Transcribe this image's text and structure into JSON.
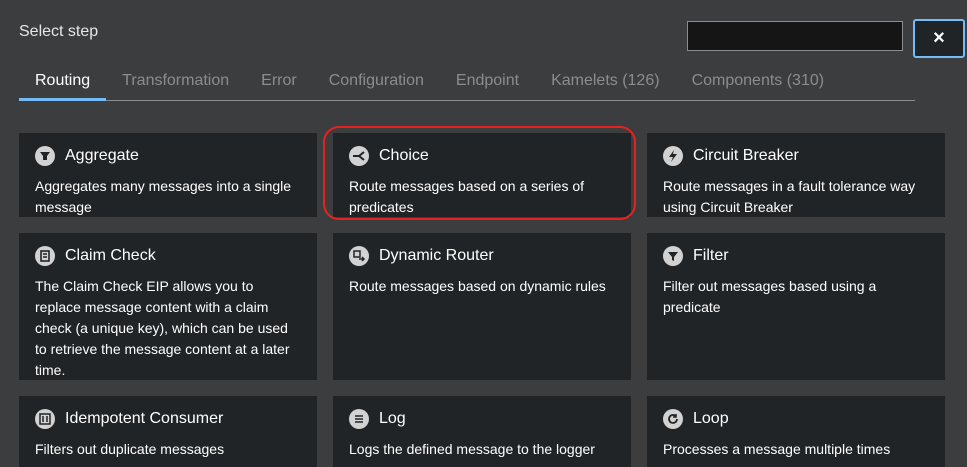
{
  "header": {
    "title": "Select step",
    "search_value": "",
    "close_label": "×"
  },
  "tabs": [
    {
      "label": "Routing",
      "active": true
    },
    {
      "label": "Transformation",
      "active": false
    },
    {
      "label": "Error",
      "active": false
    },
    {
      "label": "Configuration",
      "active": false
    },
    {
      "label": "Endpoint",
      "active": false
    },
    {
      "label": "Kamelets (126)",
      "active": false
    },
    {
      "label": "Components (310)",
      "active": false
    }
  ],
  "cards": [
    {
      "title": "Aggregate",
      "description": "Aggregates many messages into a single message",
      "icon": "aggregate-icon"
    },
    {
      "title": "Choice",
      "description": "Route messages based on a series of predicates",
      "icon": "choice-icon"
    },
    {
      "title": "Circuit Breaker",
      "description": "Route messages in a fault tolerance way using Circuit Breaker",
      "icon": "circuit-breaker-icon"
    },
    {
      "title": "Claim Check",
      "description": "The Claim Check EIP allows you to replace message content with a claim check (a unique key), which can be used to retrieve the message content at a later time.",
      "icon": "claim-check-icon"
    },
    {
      "title": "Dynamic Router",
      "description": "Route messages based on dynamic rules",
      "icon": "dynamic-router-icon"
    },
    {
      "title": "Filter",
      "description": "Filter out messages based using a predicate",
      "icon": "filter-icon"
    },
    {
      "title": "Idempotent Consumer",
      "description": "Filters out duplicate messages",
      "icon": "idempotent-consumer-icon"
    },
    {
      "title": "Log",
      "description": "Logs the defined message to the logger",
      "icon": "log-icon"
    },
    {
      "title": "Loop",
      "description": "Processes a message multiple times",
      "icon": "loop-icon"
    }
  ],
  "colors": {
    "background": "#3c3d3f",
    "card": "#212427",
    "active_tab_underline": "#73bcf7",
    "highlight": "#e5221f"
  }
}
